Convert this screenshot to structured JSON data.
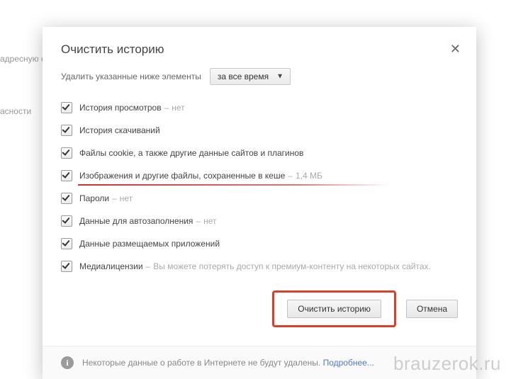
{
  "background": {
    "text1": "адресную с",
    "text2": "асности"
  },
  "dialog": {
    "title": "Очистить историю",
    "delete_label": "Удалить указанные ниже элементы",
    "time_range": "за все время",
    "items": [
      {
        "label": "История просмотров",
        "hint": "нет",
        "checked": true
      },
      {
        "label": "История скачиваний",
        "hint": "",
        "checked": true
      },
      {
        "label": "Файлы cookie, а также другие данные сайтов и плагинов",
        "hint": "",
        "checked": true
      },
      {
        "label": "Изображения и другие файлы, сохраненные в кеше",
        "hint": "1,4 МБ",
        "checked": true,
        "underline": true
      },
      {
        "label": "Пароли",
        "hint": "нет",
        "checked": true
      },
      {
        "label": "Данные для автозаполнения",
        "hint": "нет",
        "checked": true
      },
      {
        "label": "Данные размещаемых приложений",
        "hint": "",
        "checked": true
      },
      {
        "label": "Медиалицензии",
        "hint": "Вы можете потерять доступ к премиум-контенту на некоторых сайтах.",
        "checked": true
      }
    ],
    "clear_button": "Очистить историю",
    "cancel_button": "Отмена",
    "footer_text": "Некоторые данные о работе в Интернете не будут удалены.",
    "footer_link": "Подробнее..."
  },
  "watermark": "brauzerok.ru"
}
